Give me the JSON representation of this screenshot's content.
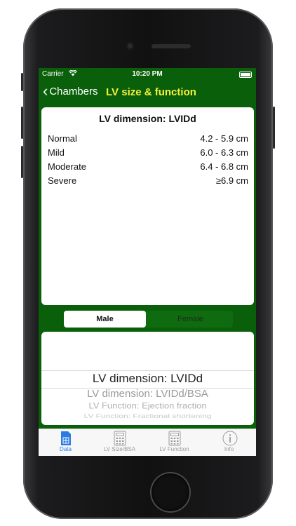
{
  "status": {
    "carrier": "Carrier",
    "time": "10:20 PM"
  },
  "nav": {
    "back_label": "Chambers",
    "title": "LV size & function"
  },
  "card": {
    "title": "LV dimension: LVIDd",
    "rows": [
      {
        "label": "Normal",
        "value": "4.2 - 5.9 cm"
      },
      {
        "label": "Mild",
        "value": "6.0 - 6.3 cm"
      },
      {
        "label": "Moderate",
        "value": "6.4 - 6.8 cm"
      },
      {
        "label": "Severe",
        "value": "≥6.9 cm"
      }
    ]
  },
  "segment": {
    "options": [
      "Male",
      "Female"
    ],
    "selected": "Male"
  },
  "picker": {
    "items": [
      "LV dimension: LVIDd",
      "LV dimension: LVIDd/BSA",
      "LV Function: Ejection fraction",
      "LV Function: Fractional shortening"
    ],
    "selected_index": 0
  },
  "tabs": [
    {
      "label": "Data",
      "icon": "data-icon",
      "active": true
    },
    {
      "label": "LV Size/BSA",
      "icon": "calculator-icon",
      "active": false
    },
    {
      "label": "LV Function",
      "icon": "calculator-icon",
      "active": false
    },
    {
      "label": "Info",
      "icon": "info-icon",
      "active": false
    }
  ],
  "colors": {
    "nav_bg": "#0a5f0a",
    "title": "#f4f23b",
    "tab_active": "#2a7be4"
  }
}
